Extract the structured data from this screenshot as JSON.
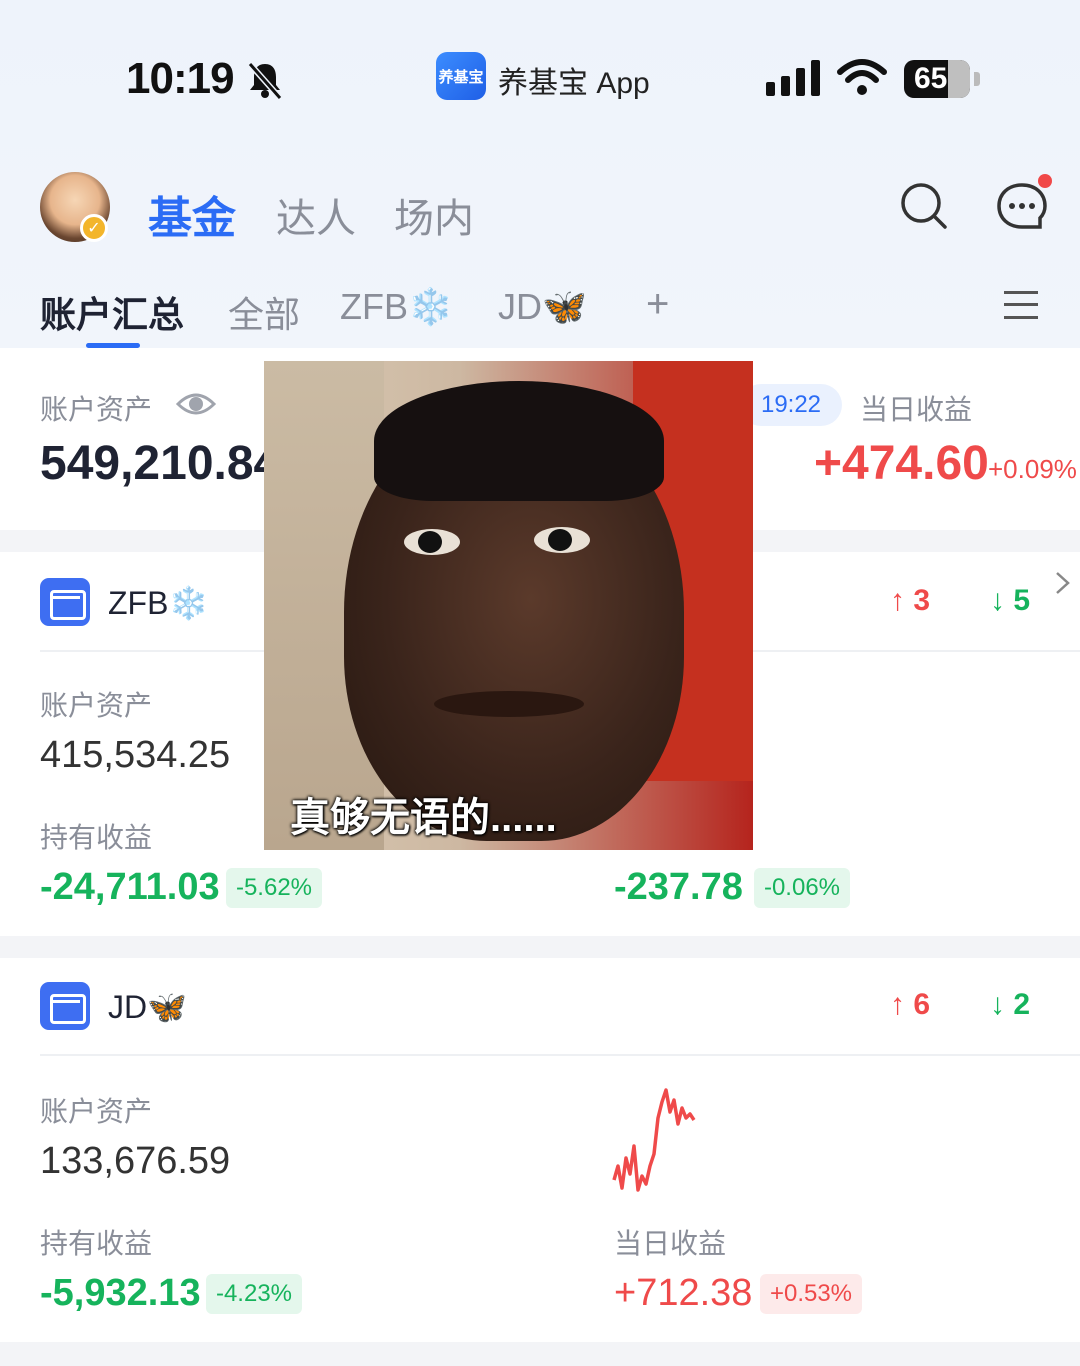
{
  "status_bar": {
    "time": "10:19",
    "app_logo_text": "养基宝",
    "app_name": "养基宝 App",
    "battery": "65"
  },
  "header": {
    "tabs": [
      "基金",
      "达人",
      "场内"
    ],
    "active_tab": "基金"
  },
  "sub_tabs": {
    "items": [
      "账户汇总",
      "全部",
      "ZFB❄️",
      "JD🦋",
      "+"
    ],
    "active": "账户汇总"
  },
  "summary": {
    "assets_label": "账户资产",
    "assets_value": "549,210.84",
    "update_time": "19:22",
    "daily_label": "当日收益",
    "daily_value": "+474.60",
    "daily_pct": "+0.09%"
  },
  "accounts": [
    {
      "name": "ZFB❄️",
      "up_count": "3",
      "down_count": "5",
      "assets_label": "账户资产",
      "assets_value": "415,534.25",
      "holding_label": "持有收益",
      "holding_value": "-24,711.03",
      "holding_pct": "-5.62%",
      "daily_value": "-237.78",
      "daily_pct": "-0.06%"
    },
    {
      "name": "JD🦋",
      "up_count": "6",
      "down_count": "2",
      "assets_label": "账户资产",
      "assets_value": "133,676.59",
      "holding_label": "持有收益",
      "holding_value": "-5,932.13",
      "holding_pct": "-4.23%",
      "daily_label": "当日收益",
      "daily_value": "+712.38",
      "daily_pct": "+0.53%"
    }
  ],
  "overlay_image": {
    "caption": "真够无语的......"
  },
  "colors": {
    "accent": "#2b6cf5",
    "up": "#ef4a4a",
    "down": "#16b35c"
  }
}
